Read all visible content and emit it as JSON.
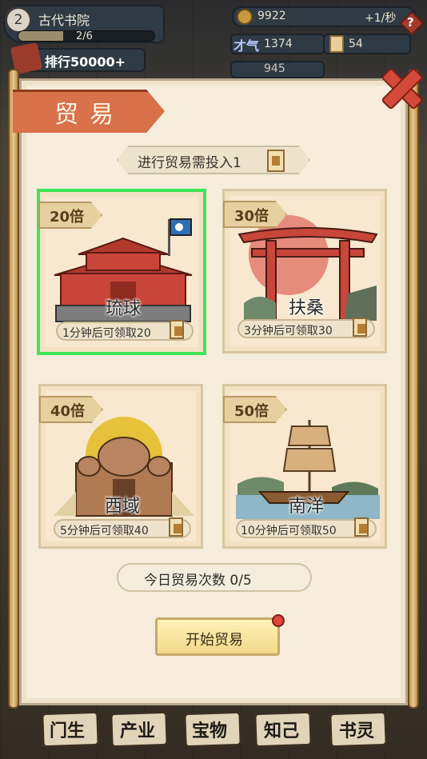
{
  "header": {
    "level": "2",
    "academy_name": "古代书院",
    "xp_progress_text": "2/6",
    "xp_fraction": 0.33,
    "rank_label": "排行",
    "rank_value": "50000+",
    "coins": "9922",
    "coin_rate": "+1/秒",
    "help": "?",
    "talent_label": "才气",
    "talent_value": "1374",
    "tickets_value": "54",
    "partial_value": "945"
  },
  "panel": {
    "title": "贸易",
    "cost_text": "进行贸易需投入1",
    "cards": [
      {
        "multiplier": "20倍",
        "name": "琉球",
        "reward": "1分钟后可领取20",
        "selected": true
      },
      {
        "multiplier": "30倍",
        "name": "扶桑",
        "reward": "3分钟后可领取30",
        "selected": false
      },
      {
        "multiplier": "40倍",
        "name": "西域",
        "reward": "5分钟后可领取40",
        "selected": false
      },
      {
        "multiplier": "50倍",
        "name": "南洋",
        "reward": "10分钟后可领取50",
        "selected": false
      }
    ],
    "trade_count_text": "今日贸易次数 0/5",
    "start_button": "开始贸易"
  },
  "bottom_nav": [
    {
      "label": "门生"
    },
    {
      "label": "产业"
    },
    {
      "label": "宝物"
    },
    {
      "label": "知己"
    },
    {
      "label": "书灵"
    }
  ],
  "colors": {
    "ribbon": "#d9714a",
    "selected_border": "#3fe45a",
    "close_red": "#d34a3a",
    "panel_bg": "#f6eddc"
  }
}
